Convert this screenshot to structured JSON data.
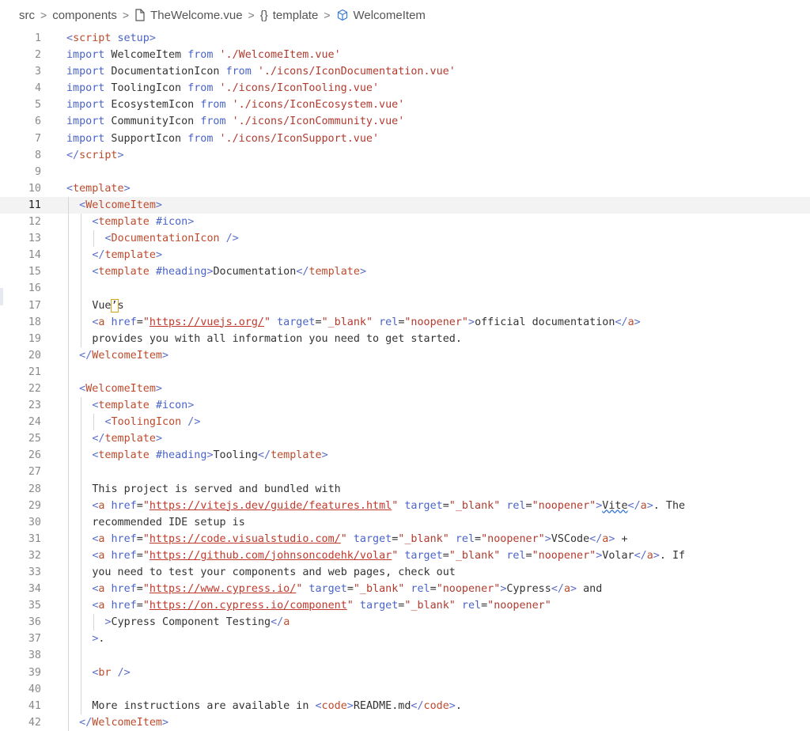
{
  "breadcrumb": {
    "items": [
      "src",
      "components",
      "TheWelcome.vue",
      "template",
      "WelcomeItem"
    ],
    "icon_file": "file-icon",
    "icon_braces_text": "{}",
    "icon_component": "component-cube-icon"
  },
  "editor": {
    "active_line": 11,
    "lines": [
      {
        "n": "1",
        "indent": 0,
        "t": [
          [
            "ang",
            "<"
          ],
          [
            "tag",
            "script"
          ],
          [
            "attr",
            " setup"
          ],
          [
            "ang",
            ">"
          ]
        ]
      },
      {
        "n": "2",
        "indent": 0,
        "t": [
          [
            "kw",
            "import"
          ],
          [
            "def",
            " WelcomeItem "
          ],
          [
            "kw",
            "from"
          ],
          [
            "def",
            " "
          ],
          [
            "str",
            "'./WelcomeItem.vue'"
          ]
        ]
      },
      {
        "n": "3",
        "indent": 0,
        "t": [
          [
            "kw",
            "import"
          ],
          [
            "def",
            " DocumentationIcon "
          ],
          [
            "kw",
            "from"
          ],
          [
            "def",
            " "
          ],
          [
            "str",
            "'./icons/IconDocumentation.vue'"
          ]
        ]
      },
      {
        "n": "4",
        "indent": 0,
        "t": [
          [
            "kw",
            "import"
          ],
          [
            "def",
            " ToolingIcon "
          ],
          [
            "kw",
            "from"
          ],
          [
            "def",
            " "
          ],
          [
            "str",
            "'./icons/IconTooling.vue'"
          ]
        ]
      },
      {
        "n": "5",
        "indent": 0,
        "t": [
          [
            "kw",
            "import"
          ],
          [
            "def",
            " EcosystemIcon "
          ],
          [
            "kw",
            "from"
          ],
          [
            "def",
            " "
          ],
          [
            "str",
            "'./icons/IconEcosystem.vue'"
          ]
        ]
      },
      {
        "n": "6",
        "indent": 0,
        "t": [
          [
            "kw",
            "import"
          ],
          [
            "def",
            " CommunityIcon "
          ],
          [
            "kw",
            "from"
          ],
          [
            "def",
            " "
          ],
          [
            "str",
            "'./icons/IconCommunity.vue'"
          ]
        ]
      },
      {
        "n": "7",
        "indent": 0,
        "t": [
          [
            "kw",
            "import"
          ],
          [
            "def",
            " SupportIcon "
          ],
          [
            "kw",
            "from"
          ],
          [
            "def",
            " "
          ],
          [
            "str",
            "'./icons/IconSupport.vue'"
          ]
        ]
      },
      {
        "n": "8",
        "indent": 0,
        "t": [
          [
            "ang",
            "</"
          ],
          [
            "tag",
            "script"
          ],
          [
            "ang",
            ">"
          ]
        ]
      },
      {
        "n": "9",
        "indent": 0,
        "t": []
      },
      {
        "n": "10",
        "indent": 0,
        "t": [
          [
            "ang",
            "<"
          ],
          [
            "tag",
            "template"
          ],
          [
            "ang",
            ">"
          ]
        ]
      },
      {
        "n": "11",
        "indent": 1,
        "t": [
          [
            "ang",
            "<"
          ],
          [
            "tag",
            "WelcomeItem"
          ],
          [
            "ang",
            ">"
          ]
        ]
      },
      {
        "n": "12",
        "indent": 2,
        "t": [
          [
            "ang",
            "<"
          ],
          [
            "tag",
            "template"
          ],
          [
            "def",
            " "
          ],
          [
            "attr",
            "#icon"
          ],
          [
            "ang",
            ">"
          ]
        ]
      },
      {
        "n": "13",
        "indent": 3,
        "t": [
          [
            "ang",
            "<"
          ],
          [
            "tag",
            "DocumentationIcon"
          ],
          [
            "def",
            " "
          ],
          [
            "ang",
            "/>"
          ]
        ]
      },
      {
        "n": "14",
        "indent": 2,
        "t": [
          [
            "ang",
            "</"
          ],
          [
            "tag",
            "template"
          ],
          [
            "ang",
            ">"
          ]
        ]
      },
      {
        "n": "15",
        "indent": 2,
        "t": [
          [
            "ang",
            "<"
          ],
          [
            "tag",
            "template"
          ],
          [
            "def",
            " "
          ],
          [
            "attr",
            "#heading"
          ],
          [
            "ang",
            ">"
          ],
          [
            "def",
            "Documentation"
          ],
          [
            "ang",
            "</"
          ],
          [
            "tag",
            "template"
          ],
          [
            "ang",
            ">"
          ]
        ]
      },
      {
        "n": "16",
        "indent": 2,
        "t": []
      },
      {
        "n": "17",
        "indent": 2,
        "t": [
          [
            "def",
            "Vue"
          ],
          [
            "cursor",
            "’"
          ],
          [
            "def",
            "s"
          ]
        ]
      },
      {
        "n": "18",
        "indent": 2,
        "t": [
          [
            "ang",
            "<"
          ],
          [
            "tag",
            "a"
          ],
          [
            "attr",
            " href"
          ],
          [
            "def",
            "="
          ],
          [
            "str",
            "\""
          ],
          [
            "url",
            "https://vuejs.org/"
          ],
          [
            "str",
            "\""
          ],
          [
            "attr",
            " target"
          ],
          [
            "def",
            "="
          ],
          [
            "str",
            "\"_blank\""
          ],
          [
            "attr",
            " rel"
          ],
          [
            "def",
            "="
          ],
          [
            "str",
            "\"noopener\""
          ],
          [
            "ang",
            ">"
          ],
          [
            "def",
            "official documentation"
          ],
          [
            "ang",
            "</"
          ],
          [
            "tag",
            "a"
          ],
          [
            "ang",
            ">"
          ]
        ]
      },
      {
        "n": "19",
        "indent": 2,
        "t": [
          [
            "def",
            "provides you with all information you need to get started."
          ]
        ]
      },
      {
        "n": "20",
        "indent": 1,
        "t": [
          [
            "ang",
            "</"
          ],
          [
            "tag",
            "WelcomeItem"
          ],
          [
            "ang",
            ">"
          ]
        ]
      },
      {
        "n": "21",
        "indent": 1,
        "t": []
      },
      {
        "n": "22",
        "indent": 1,
        "t": [
          [
            "ang",
            "<"
          ],
          [
            "tag",
            "WelcomeItem"
          ],
          [
            "ang",
            ">"
          ]
        ]
      },
      {
        "n": "23",
        "indent": 2,
        "t": [
          [
            "ang",
            "<"
          ],
          [
            "tag",
            "template"
          ],
          [
            "def",
            " "
          ],
          [
            "attr",
            "#icon"
          ],
          [
            "ang",
            ">"
          ]
        ]
      },
      {
        "n": "24",
        "indent": 3,
        "t": [
          [
            "ang",
            "<"
          ],
          [
            "tag",
            "ToolingIcon"
          ],
          [
            "def",
            " "
          ],
          [
            "ang",
            "/>"
          ]
        ]
      },
      {
        "n": "25",
        "indent": 2,
        "t": [
          [
            "ang",
            "</"
          ],
          [
            "tag",
            "template"
          ],
          [
            "ang",
            ">"
          ]
        ]
      },
      {
        "n": "26",
        "indent": 2,
        "t": [
          [
            "ang",
            "<"
          ],
          [
            "tag",
            "template"
          ],
          [
            "def",
            " "
          ],
          [
            "attr",
            "#heading"
          ],
          [
            "ang",
            ">"
          ],
          [
            "def",
            "Tooling"
          ],
          [
            "ang",
            "</"
          ],
          [
            "tag",
            "template"
          ],
          [
            "ang",
            ">"
          ]
        ]
      },
      {
        "n": "27",
        "indent": 2,
        "t": []
      },
      {
        "n": "28",
        "indent": 2,
        "t": [
          [
            "def",
            "This project is served and bundled with"
          ]
        ]
      },
      {
        "n": "29",
        "indent": 2,
        "t": [
          [
            "ang",
            "<"
          ],
          [
            "tag",
            "a"
          ],
          [
            "attr",
            " href"
          ],
          [
            "def",
            "="
          ],
          [
            "str",
            "\""
          ],
          [
            "url",
            "https://vitejs.dev/guide/features.html"
          ],
          [
            "str",
            "\""
          ],
          [
            "attr",
            " target"
          ],
          [
            "def",
            "="
          ],
          [
            "str",
            "\"_blank\""
          ],
          [
            "attr",
            " rel"
          ],
          [
            "def",
            "="
          ],
          [
            "str",
            "\"noopener\""
          ],
          [
            "ang",
            ">"
          ],
          [
            "squig",
            "Vite"
          ],
          [
            "ang",
            "</"
          ],
          [
            "tag",
            "a"
          ],
          [
            "ang",
            ">"
          ],
          [
            "def",
            ". The"
          ]
        ]
      },
      {
        "n": "30",
        "indent": 2,
        "t": [
          [
            "def",
            "recommended IDE setup is"
          ]
        ]
      },
      {
        "n": "31",
        "indent": 2,
        "t": [
          [
            "ang",
            "<"
          ],
          [
            "tag",
            "a"
          ],
          [
            "attr",
            " href"
          ],
          [
            "def",
            "="
          ],
          [
            "str",
            "\""
          ],
          [
            "url",
            "https://code.visualstudio.com/"
          ],
          [
            "str",
            "\""
          ],
          [
            "attr",
            " target"
          ],
          [
            "def",
            "="
          ],
          [
            "str",
            "\"_blank\""
          ],
          [
            "attr",
            " rel"
          ],
          [
            "def",
            "="
          ],
          [
            "str",
            "\"noopener\""
          ],
          [
            "ang",
            ">"
          ],
          [
            "def",
            "VSCode"
          ],
          [
            "ang",
            "</"
          ],
          [
            "tag",
            "a"
          ],
          [
            "ang",
            ">"
          ],
          [
            "def",
            " +"
          ]
        ]
      },
      {
        "n": "32",
        "indent": 2,
        "t": [
          [
            "ang",
            "<"
          ],
          [
            "tag",
            "a"
          ],
          [
            "attr",
            " href"
          ],
          [
            "def",
            "="
          ],
          [
            "str",
            "\""
          ],
          [
            "url",
            "https://github.com/johnsoncodehk/volar"
          ],
          [
            "str",
            "\""
          ],
          [
            "attr",
            " target"
          ],
          [
            "def",
            "="
          ],
          [
            "str",
            "\"_blank\""
          ],
          [
            "attr",
            " rel"
          ],
          [
            "def",
            "="
          ],
          [
            "str",
            "\"noopener\""
          ],
          [
            "ang",
            ">"
          ],
          [
            "def",
            "Volar"
          ],
          [
            "ang",
            "</"
          ],
          [
            "tag",
            "a"
          ],
          [
            "ang",
            ">"
          ],
          [
            "def",
            ". If"
          ]
        ]
      },
      {
        "n": "33",
        "indent": 2,
        "t": [
          [
            "def",
            "you need to test your components and web pages, check out"
          ]
        ]
      },
      {
        "n": "34",
        "indent": 2,
        "t": [
          [
            "ang",
            "<"
          ],
          [
            "tag",
            "a"
          ],
          [
            "attr",
            " href"
          ],
          [
            "def",
            "="
          ],
          [
            "str",
            "\""
          ],
          [
            "url",
            "https://www.cypress.io/"
          ],
          [
            "str",
            "\""
          ],
          [
            "attr",
            " target"
          ],
          [
            "def",
            "="
          ],
          [
            "str",
            "\"_blank\""
          ],
          [
            "attr",
            " rel"
          ],
          [
            "def",
            "="
          ],
          [
            "str",
            "\"noopener\""
          ],
          [
            "ang",
            ">"
          ],
          [
            "def",
            "Cypress"
          ],
          [
            "ang",
            "</"
          ],
          [
            "tag",
            "a"
          ],
          [
            "ang",
            ">"
          ],
          [
            "def",
            " and"
          ]
        ]
      },
      {
        "n": "35",
        "indent": 2,
        "t": [
          [
            "ang",
            "<"
          ],
          [
            "tag",
            "a"
          ],
          [
            "attr",
            " href"
          ],
          [
            "def",
            "="
          ],
          [
            "str",
            "\""
          ],
          [
            "url",
            "https://on.cypress.io/component"
          ],
          [
            "str",
            "\""
          ],
          [
            "attr",
            " target"
          ],
          [
            "def",
            "="
          ],
          [
            "str",
            "\"_blank\""
          ],
          [
            "attr",
            " rel"
          ],
          [
            "def",
            "="
          ],
          [
            "str",
            "\"noopener\""
          ]
        ]
      },
      {
        "n": "36",
        "indent": 3,
        "t": [
          [
            "ang",
            ">"
          ],
          [
            "def",
            "Cypress Component Testing"
          ],
          [
            "ang",
            "</"
          ],
          [
            "tag",
            "a"
          ]
        ]
      },
      {
        "n": "37",
        "indent": 2,
        "t": [
          [
            "ang",
            ">"
          ],
          [
            "def",
            "."
          ]
        ]
      },
      {
        "n": "38",
        "indent": 2,
        "t": []
      },
      {
        "n": "39",
        "indent": 2,
        "t": [
          [
            "ang",
            "<"
          ],
          [
            "tag",
            "br"
          ],
          [
            "def",
            " "
          ],
          [
            "ang",
            "/>"
          ]
        ]
      },
      {
        "n": "40",
        "indent": 2,
        "t": []
      },
      {
        "n": "41",
        "indent": 2,
        "t": [
          [
            "def",
            "More instructions are available in "
          ],
          [
            "ang",
            "<"
          ],
          [
            "tag",
            "code"
          ],
          [
            "ang",
            ">"
          ],
          [
            "def",
            "README.md"
          ],
          [
            "ang",
            "</"
          ],
          [
            "tag",
            "code"
          ],
          [
            "ang",
            ">"
          ],
          [
            "def",
            "."
          ]
        ]
      },
      {
        "n": "42",
        "indent": 1,
        "t": [
          [
            "ang",
            "</"
          ],
          [
            "tag",
            "WelcomeItem"
          ],
          [
            "ang",
            ">"
          ]
        ]
      }
    ]
  }
}
